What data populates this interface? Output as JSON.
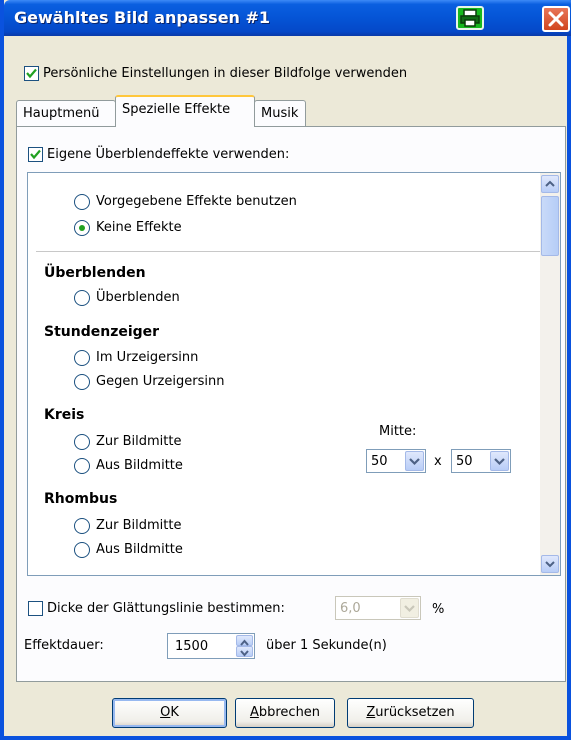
{
  "window": {
    "title": "Gewähltes Bild anpassen #1"
  },
  "personal_settings": {
    "label": "Persönliche Einstellungen in dieser Bildfolge verwenden",
    "checked": true
  },
  "tabs": [
    {
      "label": "Hauptmenü",
      "active": false
    },
    {
      "label": "Spezielle Effekte",
      "active": true
    },
    {
      "label": "Musik",
      "active": false
    }
  ],
  "own_effects": {
    "label": "Eigene Überblendeffekte verwenden:",
    "checked": true
  },
  "effects": {
    "preset_options": [
      {
        "label": "Vorgegebene Effekte benutzen",
        "selected": false
      },
      {
        "label": "Keine Effekte",
        "selected": true
      }
    ],
    "sections": [
      {
        "heading": "Überblenden",
        "options": [
          "Überblenden"
        ]
      },
      {
        "heading": "Stundenzeiger",
        "options": [
          "Im Urzeigersinn",
          "Gegen Urzeigersinn"
        ]
      },
      {
        "heading": "Kreis",
        "options": [
          "Zur Bildmitte",
          "Aus Bildmitte"
        ]
      },
      {
        "heading": "Rhombus",
        "options": [
          "Zur Bildmitte",
          "Aus Bildmitte"
        ]
      }
    ],
    "center": {
      "label": "Mitte:",
      "x_value": "50",
      "separator": "x",
      "y_value": "50"
    }
  },
  "smoothing": {
    "label": "Dicke der Glättungslinie bestimmen:",
    "checked": false,
    "value": "6,0",
    "unit": "%"
  },
  "duration": {
    "label": "Effektdauer:",
    "value": "1500",
    "suffix": "über 1 Sekunde(n)"
  },
  "buttons": {
    "ok": {
      "ul": "O",
      "rest": "K"
    },
    "cancel": {
      "ul": "A",
      "rest": "bbrechen"
    },
    "reset": {
      "ul": "Z",
      "rest": "urücksetzen"
    }
  },
  "colors": {
    "title_bar": "#0554d6",
    "close": "#d2451e",
    "printer": "#16b81e",
    "check": "#21a121"
  },
  "icons": [
    "printer-icon",
    "close-icon",
    "check-icon",
    "chevron-up-icon",
    "chevron-down-icon"
  ]
}
